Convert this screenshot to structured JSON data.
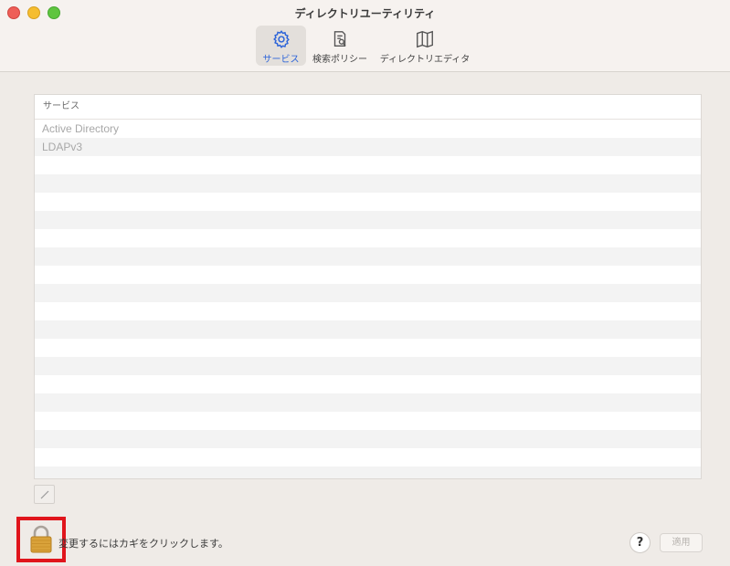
{
  "window": {
    "title": "ディレクトリユーティリティ"
  },
  "toolbar": {
    "items": [
      {
        "label": "サービス",
        "icon": "gear-icon",
        "selected": true
      },
      {
        "label": "検索ポリシー",
        "icon": "search-document-icon",
        "selected": false
      },
      {
        "label": "ディレクトリエディタ",
        "icon": "map-icon",
        "selected": false
      }
    ]
  },
  "services_table": {
    "header": "サービス",
    "rows": [
      "Active Directory",
      "LDAPv3"
    ]
  },
  "footer": {
    "lock_message": "変更するにはカギをクリックします。",
    "help_label": "?",
    "apply_label": "適用"
  },
  "colors": {
    "accent": "#2b63d9",
    "highlight_border": "#e0151c"
  }
}
